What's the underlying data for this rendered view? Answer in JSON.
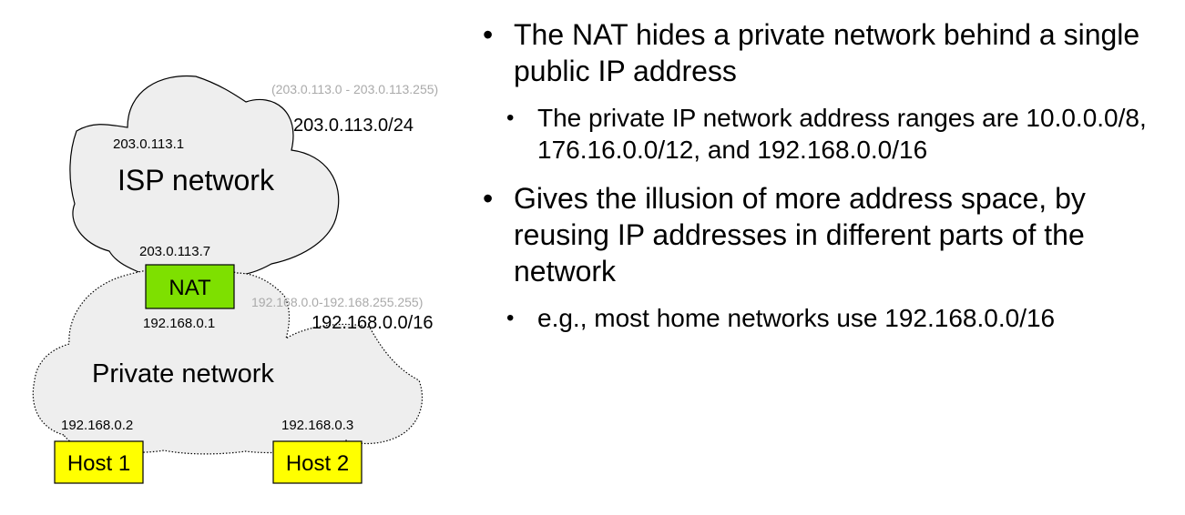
{
  "diagram": {
    "isp": {
      "label": "ISP network",
      "range": "(203.0.113.0 - 203.0.113.255)",
      "prefix": "203.0.113.0/24",
      "router_ip": "203.0.113.1",
      "nat_public_ip": "203.0.113.7"
    },
    "nat": {
      "label": "NAT",
      "private_ip": "192.168.0.1"
    },
    "private": {
      "label": "Private network",
      "range": "192.168.0.0-192.168.255.255)",
      "prefix": "192.168.0.0/16"
    },
    "hosts": [
      {
        "label": "Host 1",
        "ip": "192.168.0.2"
      },
      {
        "label": "Host 2",
        "ip": "192.168.0.3"
      }
    ],
    "colors": {
      "cloud_fill": "#eeeeee",
      "cloud_stroke": "#000000",
      "nat_fill": "#7ee000",
      "host_fill": "#ffff00",
      "range_text": "#aaaaaa"
    }
  },
  "bullets": {
    "b1": "The NAT hides a private network behind a single public IP address",
    "b1_1": "The private IP network address ranges are 10.0.0.0/8, 176.16.0.0/12, and 192.168.0.0/16",
    "b2": "Gives the illusion of more address space, by reusing IP addresses in different parts of the network",
    "b2_1": "e.g., most home networks use 192.168.0.0/16"
  }
}
